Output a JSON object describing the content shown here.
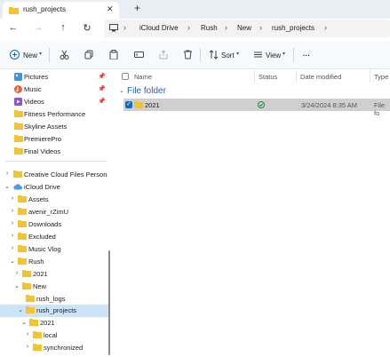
{
  "tab": {
    "title": "rush_projects",
    "close_glyph": "✕",
    "new_tab_glyph": "+"
  },
  "nav": {
    "back_glyph": "←",
    "forward_glyph": "→",
    "up_glyph": "↑",
    "refresh_glyph": "↻"
  },
  "breadcrumb": {
    "separator": "›",
    "items": [
      "iCloud Drive",
      "Rush",
      "New",
      "rush_projects"
    ]
  },
  "commands": {
    "new_label": "New",
    "sort_label": "Sort",
    "view_label": "View",
    "more_label": "···"
  },
  "sidebar": {
    "items": [
      {
        "label": "Pictures",
        "icon": "pictures-icon",
        "pinned": true
      },
      {
        "label": "Music",
        "icon": "music-icon",
        "pinned": true
      },
      {
        "label": "Videos",
        "icon": "videos-icon",
        "pinned": true
      },
      {
        "label": "Fitness Performance",
        "icon": "folder-icon"
      },
      {
        "label": "Skyline Assets",
        "icon": "folder-icon"
      },
      {
        "label": "PremierePro",
        "icon": "folder-icon"
      },
      {
        "label": "Final Videos",
        "icon": "folder-icon"
      }
    ],
    "tree": [
      {
        "label": "Creative Cloud Files Personal A",
        "icon": "folder-icon",
        "expanded": false
      },
      {
        "label": "iCloud Drive",
        "icon": "icloud-icon",
        "expanded": true
      },
      {
        "label": "Assets",
        "icon": "folder-icon",
        "expanded": false
      },
      {
        "label": "avenir_rZimU",
        "icon": "folder-icon",
        "expanded": false
      },
      {
        "label": "Downloads",
        "icon": "folder-icon",
        "expanded": false
      },
      {
        "label": "Excluded",
        "icon": "folder-icon",
        "expanded": false
      },
      {
        "label": "Music Vlog",
        "icon": "folder-icon",
        "expanded": false
      },
      {
        "label": "Rush",
        "icon": "folder-icon",
        "expanded": true
      },
      {
        "label": "2021",
        "icon": "folder-icon",
        "expanded": false
      },
      {
        "label": "New",
        "icon": "folder-icon",
        "expanded": true
      },
      {
        "label": "rush_logs",
        "icon": "folder-icon",
        "expanded": null
      },
      {
        "label": "rush_projects",
        "icon": "folder-icon",
        "expanded": true,
        "selected": true
      },
      {
        "label": "2021",
        "icon": "folder-icon",
        "expanded": true
      },
      {
        "label": "local",
        "icon": "folder-icon",
        "expanded": false
      },
      {
        "label": "synchronized",
        "icon": "folder-icon",
        "expanded": false
      }
    ]
  },
  "columns": {
    "name": "Name",
    "status": "Status",
    "date": "Date modified",
    "type": "Type"
  },
  "group": {
    "label": "File folder"
  },
  "files": [
    {
      "name": "2021",
      "status_icon": "synced-check-icon",
      "date": "3/24/2024 8:35 AM",
      "type": "File fo"
    }
  ],
  "colors": {
    "accent": "#0f6cbd",
    "folder": "#f4c430",
    "group_header": "#2a5db0",
    "selection": "#cce4f7"
  }
}
